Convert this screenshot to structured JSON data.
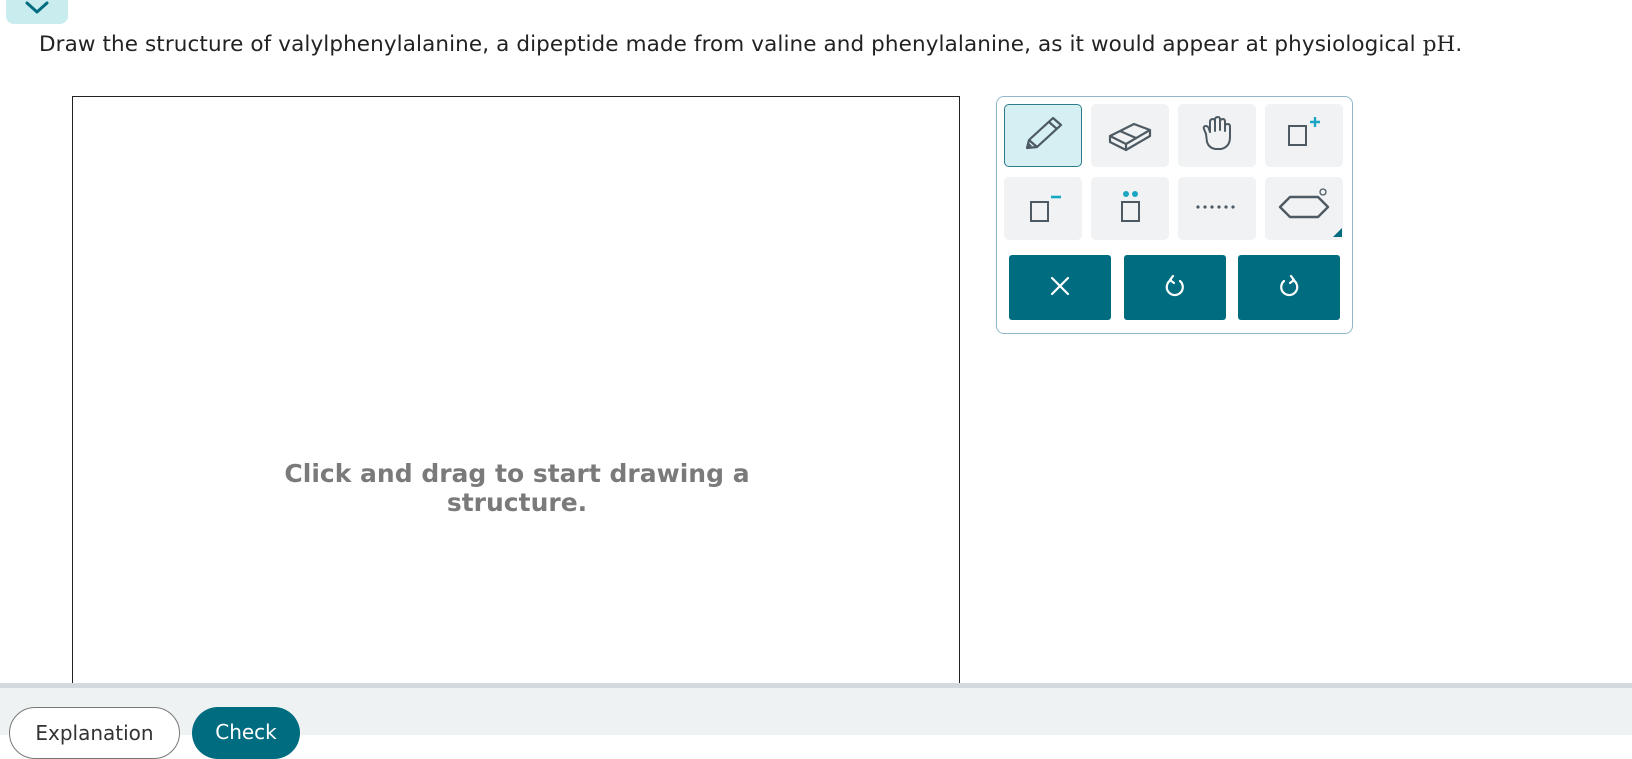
{
  "question": {
    "text": "Draw the structure of valylphenylalanine, a dipeptide made from valine and phenylalanine, as it would appear at physiological ",
    "math": "pH",
    "end": "."
  },
  "canvas": {
    "placeholder_line1": "Click and drag to start drawing a",
    "placeholder_line2": "structure."
  },
  "toolbar": {
    "tools": [
      {
        "name": "pencil-icon",
        "active": true
      },
      {
        "name": "eraser-icon",
        "active": false
      },
      {
        "name": "hand-icon",
        "active": false
      },
      {
        "name": "positive-charge-icon",
        "active": false
      },
      {
        "name": "negative-charge-icon",
        "active": false
      },
      {
        "name": "lone-pair-icon",
        "active": false
      },
      {
        "name": "dotted-bond-icon",
        "active": false
      },
      {
        "name": "ring-template-icon",
        "active": false
      }
    ],
    "actions": [
      "close-icon",
      "undo-icon",
      "redo-icon"
    ],
    "accent_color": "#006c80",
    "charge_color": "#1aa6c2"
  },
  "footer": {
    "explanation_label": "Explanation",
    "check_label": "Check"
  }
}
